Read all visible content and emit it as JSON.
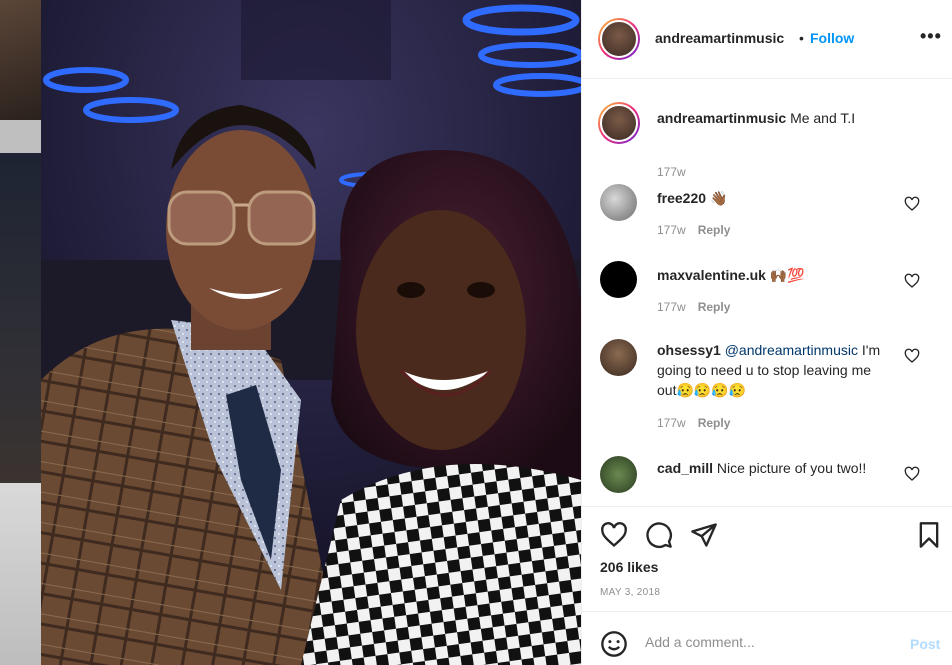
{
  "post": {
    "username": "andreamartinmusic",
    "separator": "•",
    "follow_label": "Follow",
    "more_label": "•••"
  },
  "caption": {
    "username": "andreamartinmusic",
    "text": "Me and T.I",
    "age": "177w"
  },
  "comments": [
    {
      "username": "free220",
      "text": "👋🏾",
      "age": "177w",
      "reply_label": "Reply"
    },
    {
      "username": "maxvalentine.uk",
      "text": "🙌🏾💯",
      "age": "177w",
      "reply_label": "Reply"
    },
    {
      "username": "ohsessy1",
      "mention": "@andreamartinmusic",
      "text": "I'm going to need u to stop leaving me out😥😥😥😥",
      "age": "177w",
      "reply_label": "Reply"
    },
    {
      "username": "cad_mill",
      "text": "Nice picture of you two!!"
    }
  ],
  "actions": {
    "likes": "206 likes",
    "date": "MAY 3, 2018"
  },
  "add_comment": {
    "placeholder": "Add a comment...",
    "post_label": "Post"
  },
  "colors": {
    "link_blue": "#0095f6",
    "post_disabled": "#b3dbff",
    "muted": "#8e8e8e"
  }
}
